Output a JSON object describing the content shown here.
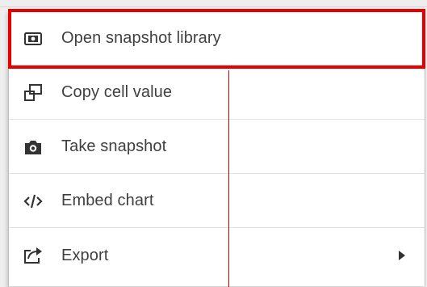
{
  "menu": {
    "items": [
      {
        "label": "Open snapshot library",
        "icon": "snapshot-library-icon"
      },
      {
        "label": "Copy cell value",
        "icon": "copy-icon"
      },
      {
        "label": "Take snapshot",
        "icon": "camera-icon"
      },
      {
        "label": "Embed chart",
        "icon": "code-icon"
      },
      {
        "label": "Export",
        "icon": "export-icon",
        "submenu_indicator": "triangle-right-icon"
      }
    ]
  },
  "colors": {
    "highlight": "#e60000",
    "text": "#404040",
    "icon": "#333333"
  }
}
